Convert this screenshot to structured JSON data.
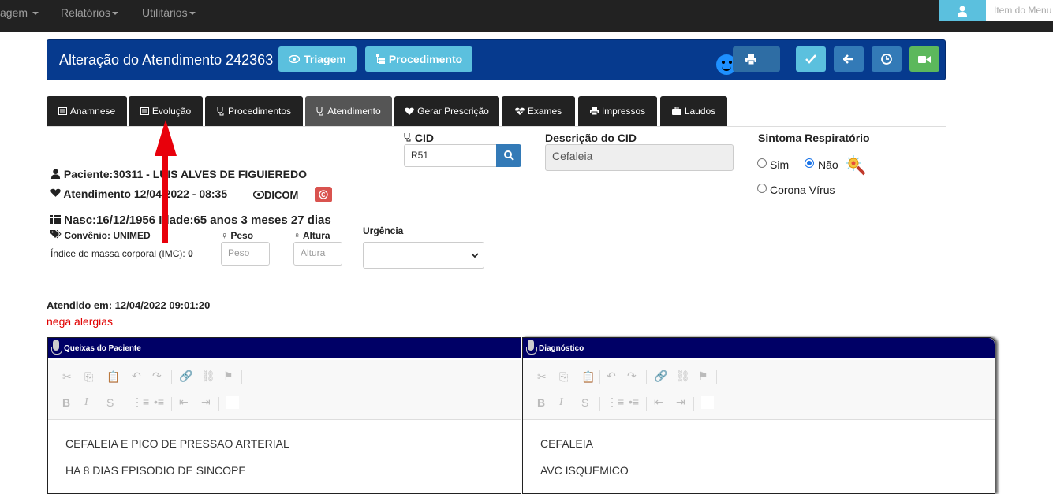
{
  "topbar": {
    "menu_partial": "agem",
    "menu_reports": "Relatórios",
    "menu_utils": "Utilitários",
    "menu_item_placeholder": "Item do Menu"
  },
  "header": {
    "title": "Alteração do Atendimento 242363",
    "triage_label": "Triagem",
    "procedure_label": "Procedimento"
  },
  "tabs": [
    {
      "label": "Anamnese",
      "icon": "list-alt-icon"
    },
    {
      "label": "Evolução",
      "icon": "list-alt-icon"
    },
    {
      "label": "Procedimentos",
      "icon": "stethoscope-icon"
    },
    {
      "label": "Atendimento",
      "icon": "stethoscope-icon"
    },
    {
      "label": "Gerar Prescrição",
      "icon": "heart-icon"
    },
    {
      "label": "Exames",
      "icon": "heartbeat-icon"
    },
    {
      "label": "Impressos",
      "icon": "print-icon"
    },
    {
      "label": "Laudos",
      "icon": "briefcase-icon"
    }
  ],
  "patient": {
    "name_line": "Paciente:30311 - LUIS ALVES DE FIGUIEREDO",
    "attendance_line": "Atendimento 12/04/2022 - 08:35",
    "dicom_label": "DICOM",
    "birth_line": "Nasc:16/12/1956 Idade:65 anos 3 meses 27 dias",
    "insurance_line": "Convênio: UNIMED",
    "bmi_label": "Índice de massa corporal (IMC):",
    "bmi_value": "0"
  },
  "measures": {
    "weight_label": "Peso",
    "weight_placeholder": "Peso",
    "height_label": "Altura",
    "height_placeholder": "Altura",
    "urgency_label": "Urgência",
    "urgency_value": ""
  },
  "cid": {
    "label": "CID",
    "value": "R51",
    "description_label": "Descrição do CID",
    "description_value": "Cefaleia"
  },
  "respiratory": {
    "label": "Sintoma Respiratório",
    "yes": "Sim",
    "no": "Não",
    "corona": "Corona Vírus",
    "selected": "Não"
  },
  "attended": {
    "line": "Atendido em: 12/04/2022 09:01:20",
    "allergy_note": "nega alergias"
  },
  "panels": {
    "complaints_title": "Queixas do Paciente",
    "complaints_lines": [
      "CEFALEIA E PICO DE PRESSAO ARTERIAL",
      "HA 8 DIAS EPISODIO DE SINCOPE"
    ],
    "diagnosis_title": "Diagnóstico",
    "diagnosis_lines": [
      "CEFALEIA",
      "AVC ISQUEMICO"
    ]
  },
  "colors": {
    "header_bg": "#063a8e",
    "panel_head_bg": "#000066",
    "arrow": "#e8000b",
    "info": "#5bc0de",
    "primary": "#337ab7",
    "success": "#5cb85c"
  }
}
